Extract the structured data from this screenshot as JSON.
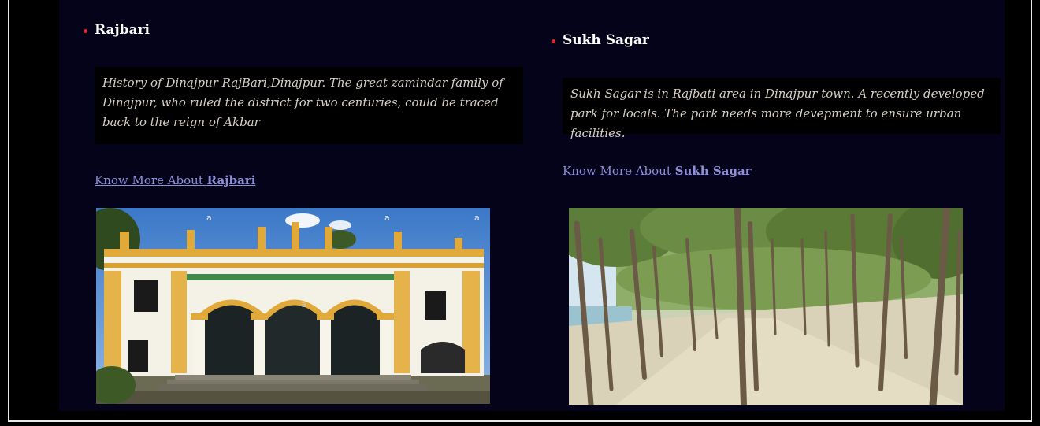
{
  "sections": [
    {
      "title": "Rajbari",
      "description": "History of Dinajpur RajBari,Dinajpur. The great zamindar family of Dinajpur, who ruled the district for two centuries, could be traced back to the reign of Akbar",
      "link_prefix": "Know More About ",
      "link_name": "Rajbari",
      "image": {
        "subject": "palace-building",
        "watermark": "a"
      }
    },
    {
      "title": "Sukh Sagar",
      "description": "Sukh Sagar is in Rajbati area in Dinajpur town. A recently developed park for locals. The park needs more devepment to ensure urban facilities.",
      "link_prefix": "Know More About ",
      "link_name": "Sukh Sagar",
      "image": {
        "subject": "tree-grove"
      }
    }
  ],
  "colors": {
    "page_bg": "#000000",
    "panel_bg": "#04031a",
    "bullet": "#e0262c",
    "link": "#8f8fd8",
    "heading": "#ffffff"
  }
}
